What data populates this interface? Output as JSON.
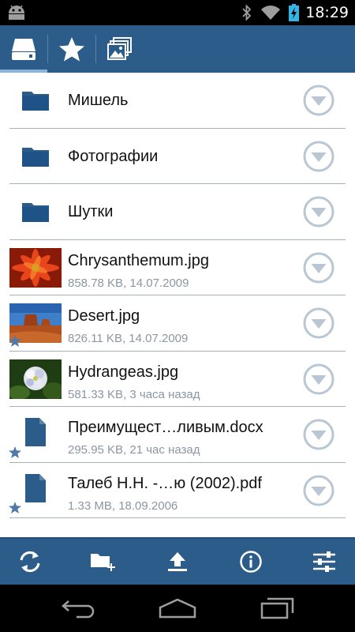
{
  "status_bar": {
    "time": "18:29",
    "icons": [
      "android-icon",
      "bluetooth-icon",
      "wifi-icon",
      "battery-charging-icon"
    ]
  },
  "tabs": [
    {
      "icon": "storage-icon",
      "selected": true
    },
    {
      "icon": "star-icon",
      "selected": false
    },
    {
      "icon": "gallery-icon",
      "selected": false
    }
  ],
  "files": [
    {
      "type": "folder",
      "name": "Мишель"
    },
    {
      "type": "folder",
      "name": "Фотографии"
    },
    {
      "type": "folder",
      "name": "Шутки"
    },
    {
      "type": "image",
      "name": "Chrysanthemum.jpg",
      "meta": "858.78 KB, 14.07.2009",
      "starred": false
    },
    {
      "type": "image",
      "name": "Desert.jpg",
      "meta": "826.11 KB, 14.07.2009",
      "starred": true
    },
    {
      "type": "image",
      "name": "Hydrangeas.jpg",
      "meta": "581.33 KB, 3 часа назад",
      "starred": false
    },
    {
      "type": "document",
      "name": "Преимущест…ливым.docx",
      "meta": "295.95 KB, 21 час назад",
      "starred": true
    },
    {
      "type": "document",
      "name": "Талеб Н.Н. -…ю (2002).pdf",
      "meta": "1.33 MB, 18.09.2006",
      "starred": true
    }
  ],
  "actions": [
    "refresh-icon",
    "new-folder-icon",
    "upload-icon",
    "info-icon",
    "settings-sliders-icon"
  ],
  "nav": [
    "back-icon",
    "home-icon",
    "recent-apps-icon"
  ],
  "colors": {
    "accent": "#2c5c8a",
    "tab_indicator": "#8cb3d9",
    "meta_text": "#8a97a3",
    "menu_button": "#b9c6d3"
  }
}
